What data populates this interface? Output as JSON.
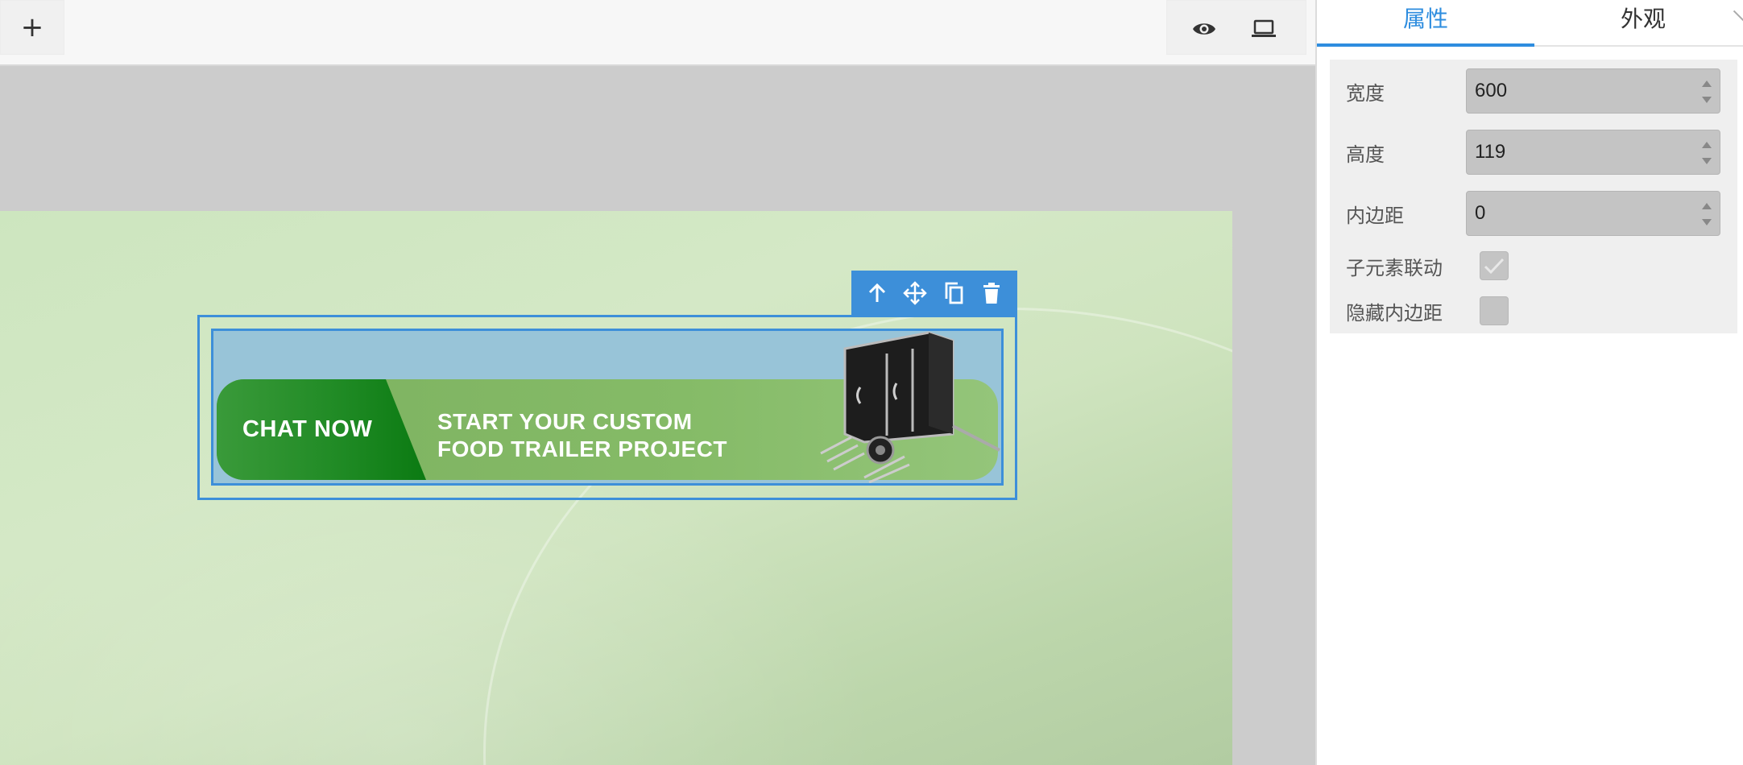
{
  "toolbar": {
    "add_label": "+",
    "preview_icon": "eye-icon",
    "device_icon": "laptop-icon"
  },
  "floating_toolbar": {
    "icons": [
      "arrow-up-icon",
      "move-icon",
      "copy-icon",
      "delete-icon"
    ]
  },
  "banner": {
    "chat_label": "CHAT NOW",
    "promo_line1": "START YOUR CUSTOM",
    "promo_line2": "FOOD TRAILER PROJECT"
  },
  "panel": {
    "tabs": [
      {
        "label": "属性",
        "active": true
      },
      {
        "label": "外观",
        "active": false
      }
    ],
    "fields": {
      "width": {
        "label": "宽度",
        "value": "600"
      },
      "height": {
        "label": "高度",
        "value": "119"
      },
      "padding": {
        "label": "内边距",
        "value": "0"
      },
      "child_link": {
        "label": "子元素联动",
        "checked": true
      },
      "hide_padding": {
        "label": "隐藏内边距",
        "checked": false
      }
    }
  },
  "colors": {
    "accent": "#3d8fd9",
    "tab_active": "#2e8ddf",
    "banner_green": "#0b7a12"
  }
}
